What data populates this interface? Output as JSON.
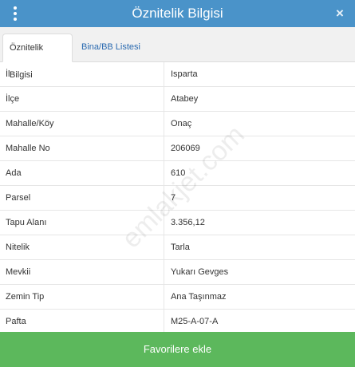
{
  "header": {
    "title": "Öznitelik Bilgisi",
    "close_glyph": "×"
  },
  "tabs": [
    {
      "label": "Öznitelik Bilgisi",
      "active": true
    },
    {
      "label": "Bina/BB Listesi",
      "active": false
    }
  ],
  "rows": [
    {
      "label": "İl",
      "value": "Isparta"
    },
    {
      "label": "İlçe",
      "value": "Atabey"
    },
    {
      "label": "Mahalle/Köy",
      "value": "Onaç"
    },
    {
      "label": "Mahalle No",
      "value": "206069"
    },
    {
      "label": "Ada",
      "value": "610"
    },
    {
      "label": "Parsel",
      "value": "7"
    },
    {
      "label": "Tapu Alanı",
      "value": "3.356,12"
    },
    {
      "label": "Nitelik",
      "value": "Tarla"
    },
    {
      "label": "Mevkii",
      "value": "Yukarı Gevges"
    },
    {
      "label": "Zemin Tip",
      "value": "Ana Taşınmaz"
    },
    {
      "label": "Pafta",
      "value": "M25-A-07-A"
    }
  ],
  "watermark": "emlakjet.com",
  "footer": {
    "button_label": "Favorilere ekle"
  },
  "colors": {
    "header_bg": "#4a93c9",
    "tab_link": "#2a6ab0",
    "footer_bg": "#5cb85c"
  },
  "icons": {
    "menu": "more-vertical-icon",
    "close": "close-icon"
  }
}
